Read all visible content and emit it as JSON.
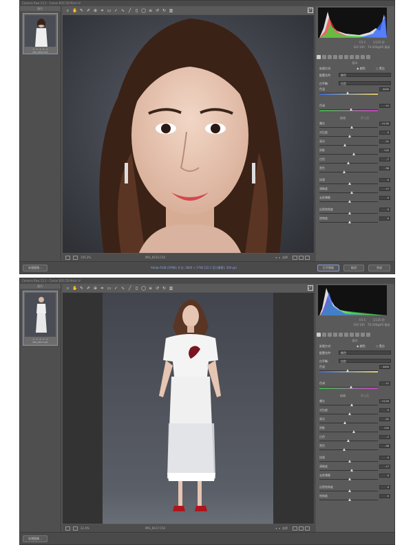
{
  "top": {
    "title": "Camera Raw 13.1 - Canon EOS 5D Mark IV",
    "filmstrip_header": "胶片",
    "thumb_label": "IMG_6615.CR2",
    "thumb_stars": "★ ★ ★ ★ ★",
    "zoom": "105.3%",
    "status_file": "IMG_6615.CR2",
    "workflow": "Adobe RGB (1998); 8 位; 3840 × 5760 (22.1 百万像素); 300 ppi",
    "nav_label": "选择",
    "buttons": {
      "save": "存储图像...",
      "open": "打开图像",
      "cancel": "取消",
      "done": "完成"
    },
    "readout": {
      "fstop": "f/3.5",
      "shutter": "1/125 秒",
      "iso": "ISO 100",
      "lens": "70-200@85 毫米"
    },
    "panel": {
      "section_basic": "基本",
      "wb_label": "处理方式:",
      "wb_color": "颜色",
      "wb_bw": "黑白",
      "profile_label": "配置文件:",
      "profile_value": "颜色",
      "wb_preset_label": "白平衡:",
      "wb_preset_value": "自定",
      "section_tone": "色调",
      "auto": "自动",
      "default": "默认值",
      "rows": [
        {
          "label": "色温",
          "value": "4400"
        },
        {
          "label": "色调",
          "value": "+1"
        },
        {
          "label": "曝光",
          "value": "+0.30"
        },
        {
          "label": "对比度",
          "value": "0"
        },
        {
          "label": "高光",
          "value": "-31"
        },
        {
          "label": "阴影",
          "value": "+25"
        },
        {
          "label": "白色",
          "value": "-7"
        },
        {
          "label": "黑色",
          "value": "-36"
        },
        {
          "label": "纹理",
          "value": "0"
        },
        {
          "label": "清晰度",
          "value": "+7"
        },
        {
          "label": "去除薄雾",
          "value": "0"
        },
        {
          "label": "自然饱和度",
          "value": "0"
        },
        {
          "label": "饱和度",
          "value": "0"
        }
      ]
    }
  },
  "bottom": {
    "title": "Camera Raw 13.1 - Canon EOS 5D Mark IV",
    "filmstrip_header": "胶片",
    "thumb_label": "IMG_6617.CR2",
    "thumb_stars": "★ ★ ★ ★ ★",
    "zoom": "22.4%",
    "status_file": "IMG_6617.CR2",
    "nav_label": "选择",
    "buttons": {
      "save": "存储图像..."
    },
    "readout": {
      "fstop": "f/3.5",
      "shutter": "1/125 秒",
      "iso": "ISO 100",
      "lens": "70-200@85 毫米"
    },
    "panel": {
      "section_basic": "基本",
      "wb_label": "处理方式:",
      "wb_color": "颜色",
      "wb_bw": "黑白",
      "profile_label": "配置文件:",
      "profile_value": "颜色",
      "wb_preset_label": "白平衡:",
      "wb_preset_value": "自定",
      "section_tone": "色调",
      "auto": "自动",
      "default": "默认值",
      "rows": [
        {
          "label": "色温",
          "value": "4400"
        },
        {
          "label": "色调",
          "value": "+1"
        },
        {
          "label": "曝光",
          "value": "+0.30"
        },
        {
          "label": "对比度",
          "value": "0"
        },
        {
          "label": "高光",
          "value": "-31"
        },
        {
          "label": "阴影",
          "value": "+25"
        },
        {
          "label": "白色",
          "value": "-7"
        },
        {
          "label": "黑色",
          "value": "-36"
        },
        {
          "label": "纹理",
          "value": "0"
        },
        {
          "label": "清晰度",
          "value": "+7"
        },
        {
          "label": "去除薄雾",
          "value": "0"
        },
        {
          "label": "自然饱和度",
          "value": "0"
        },
        {
          "label": "饱和度",
          "value": "0"
        }
      ]
    }
  },
  "colors": {
    "accent": "#8aa0d8",
    "chrome": "#555555",
    "panel": "#5a5a5a",
    "backdrop": "#3d3f45"
  }
}
